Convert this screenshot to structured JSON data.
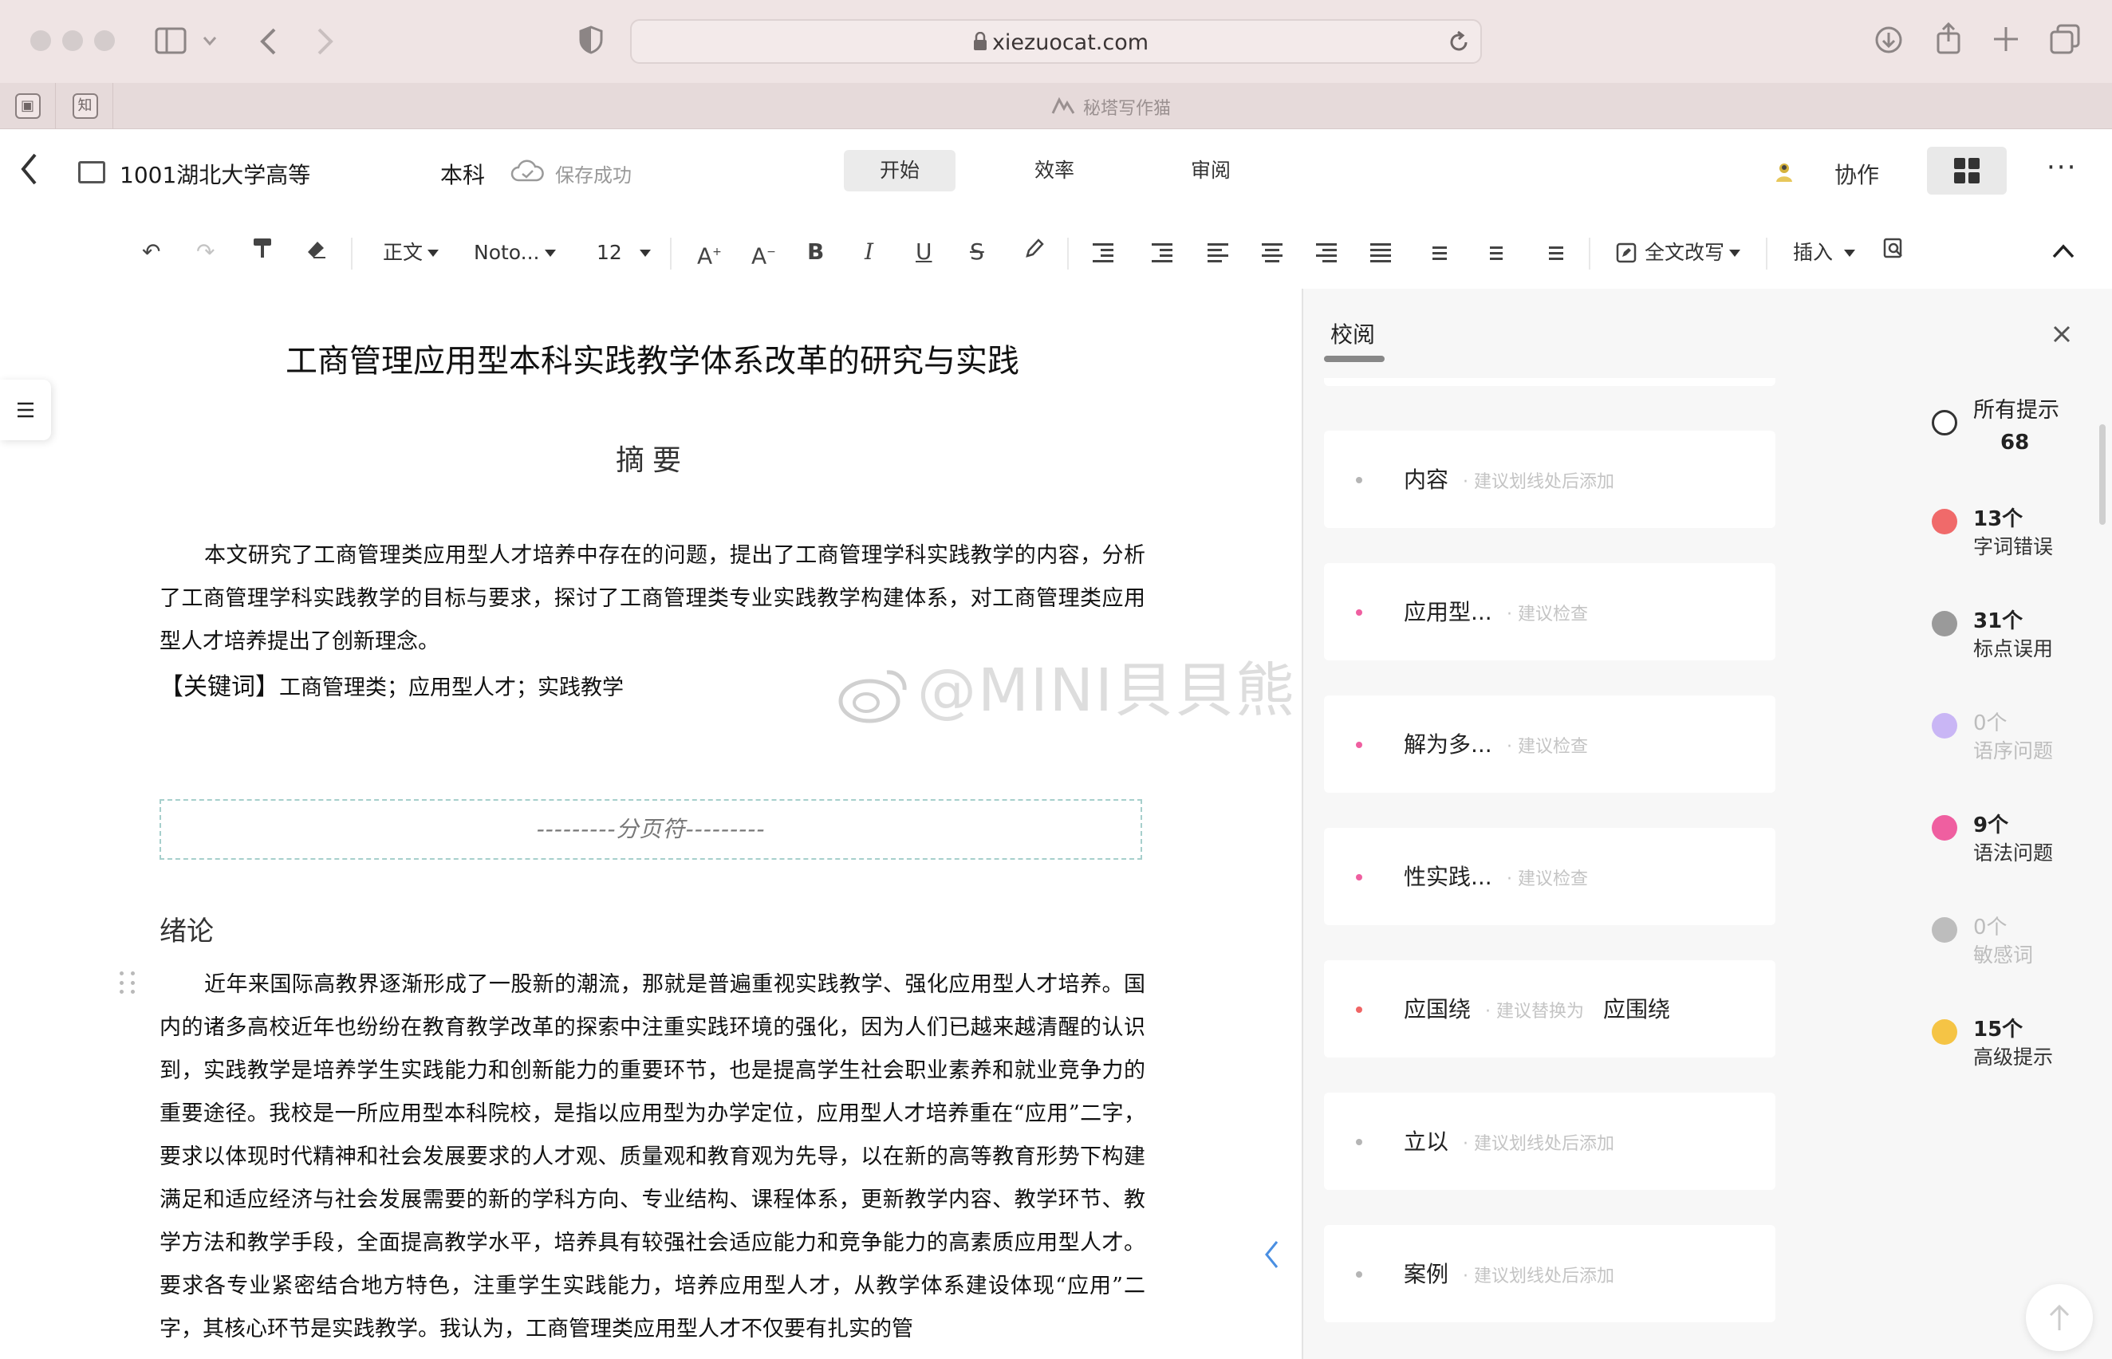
{
  "browser": {
    "url": "xiezuocat.com",
    "tab_title": "秘塔写作猫"
  },
  "header": {
    "doc_title_prefix": "1001湖北大学高等",
    "doc_title_suffix": "本科",
    "save_status": "保存成功",
    "tabs": [
      "开始",
      "效率",
      "审阅"
    ],
    "active_tab": "开始",
    "collab_label": "协作",
    "more_label": "···"
  },
  "toolbar": {
    "style_select": "正文",
    "font_select": "Noto...",
    "size_select": "12",
    "rewrite_label": "全文改写",
    "insert_label": "插入"
  },
  "document": {
    "title": "工商管理应用型本科实践教学体系改革的研究与实践",
    "abstract_title": "摘要",
    "abstract_text": "本文研究了工商管理类应用型人才培养中存在的问题，提出了工商管理学科实践教学的内容，分析了工商管理学科实践教学的目标与要求，探讨了工商管理类专业实践教学构建体系，对工商管理类应用型人才培养提出了创新理念。",
    "keywords_label": "【关键词】",
    "keywords_text": "工商管理类；应用型人才；实践教学",
    "page_break": "---------分页符---------",
    "section_heading": "绪论",
    "body_text": "近年来国际高教界逐渐形成了一股新的潮流，那就是普遍重视实践教学、强化应用型人才培养。国内的诸多高校近年也纷纷在教育教学改革的探索中注重实践环境的强化，因为人们已越来越清醒的认识到，实践教学是培养学生实践能力和创新能力的重要环节，也是提高学生社会职业素养和就业竞争力的重要途径。我校是一所应用型本科院校，是指以应用型为办学定位，应用型人才培养重在“应用”二字，要求以体现时代精神和社会发展要求的人才观、质量观和教育观为先导，以在新的高等教育形势下构建满足和适应经济与社会发展需要的新的学科方向、专业结构、课程体系，更新教学内容、教学环节、教学方法和教学手段，全面提高教学水平，培养具有较强社会适应能力和竞争能力的高素质应用型人才。要求各专业紧密结合地方特色，注重学生实践能力，培养应用型人才，从教学体系建设体现“应用”二字，其核心环节是实践教学。我认为，工商管理类应用型人才不仅要有扎实的管",
    "watermark": "@MINI貝貝熊"
  },
  "review": {
    "tab_label": "校阅",
    "items": [
      {
        "word": "内容",
        "hint": "· 建议划线处后添加",
        "replacement": "",
        "dot_color": "#b5b5b5"
      },
      {
        "word": "应用型...",
        "hint": "· 建议检查",
        "replacement": "",
        "dot_color": "#ef5fa0"
      },
      {
        "word": "解为多...",
        "hint": "· 建议检查",
        "replacement": "",
        "dot_color": "#ef5fa0"
      },
      {
        "word": "性实践...",
        "hint": "· 建议检查",
        "replacement": "",
        "dot_color": "#ef5fa0"
      },
      {
        "word": "应国绕",
        "hint": "· 建议替换为",
        "replacement": "应围绕",
        "dot_color": "#f06565"
      },
      {
        "word": "立以",
        "hint": "· 建议划线处后添加",
        "replacement": "",
        "dot_color": "#b5b5b5"
      },
      {
        "word": "案例",
        "hint": "· 建议划线处后添加",
        "replacement": "",
        "dot_color": "#b5b5b5"
      }
    ],
    "categories": [
      {
        "count": "所有提示",
        "label": "68",
        "color": "#ffffff",
        "style": "all"
      },
      {
        "count": "13个",
        "label": "字词错误",
        "color": "#f06a6a",
        "style": "normal"
      },
      {
        "count": "31个",
        "label": "标点误用",
        "color": "#9a9a9a",
        "style": "normal"
      },
      {
        "count": "0个",
        "label": "语序问题",
        "color": "#c9b6f5",
        "style": "muted"
      },
      {
        "count": "9个",
        "label": "语法问题",
        "color": "#ef5fa0",
        "style": "normal"
      },
      {
        "count": "0个",
        "label": "敏感词",
        "color": "#bdbdbd",
        "style": "muted"
      },
      {
        "count": "15个",
        "label": "高级提示",
        "color": "#f5c445",
        "style": "normal"
      }
    ]
  }
}
